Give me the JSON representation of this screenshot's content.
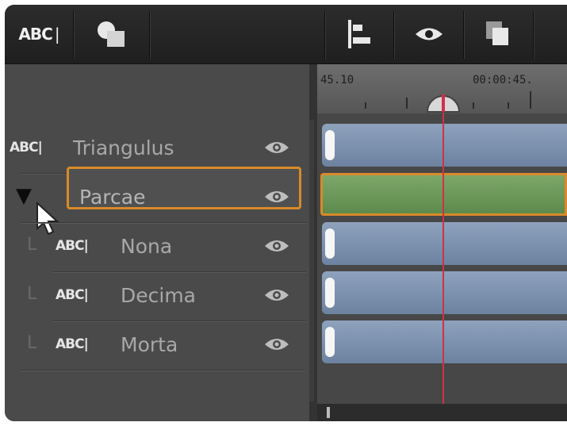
{
  "toolbar": {
    "title_tool_glyph": "ABC",
    "title_tool_cursor": "|",
    "icons": [
      "title-tool-icon",
      "shapes-icon",
      "align-icon",
      "visibility-icon",
      "duplicate-icon"
    ]
  },
  "ruler": {
    "timecode_left": "45.10",
    "timecode_right": "00:00:45."
  },
  "tracks": [
    {
      "name": "Triangulus",
      "type_glyph": "ABC|",
      "level": 0
    },
    {
      "name": "Parcae",
      "expander": "▼",
      "level": 0,
      "selected": true
    },
    {
      "name": "Nona",
      "type_glyph": "ABC|",
      "connector": "L",
      "level": 1
    },
    {
      "name": "Decima",
      "type_glyph": "ABC|",
      "connector": "L",
      "level": 1
    },
    {
      "name": "Morta",
      "type_glyph": "ABC|",
      "connector": "L",
      "level": 1
    }
  ],
  "colors": {
    "selection": "#d98a2a",
    "clip_blue": "#7a8fae",
    "clip_green": "#6e9a5b",
    "playhead": "#d0304a"
  }
}
